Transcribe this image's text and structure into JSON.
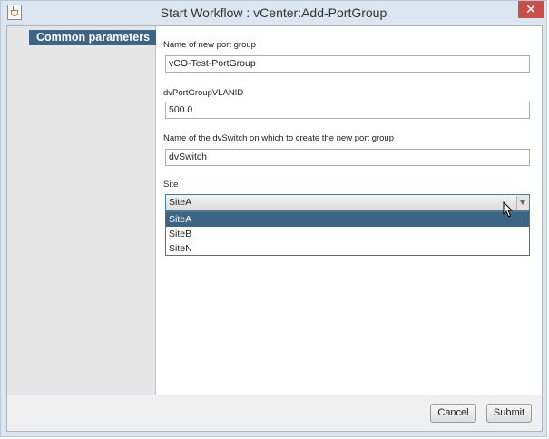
{
  "window": {
    "title": "Start Workflow : vCenter:Add-PortGroup",
    "close_glyph": "✕"
  },
  "sidebar": {
    "items": [
      {
        "label": "Common parameters",
        "selected": true
      }
    ]
  },
  "form": {
    "port_group_name": {
      "label": "Name of new port group",
      "value": "vCO-Test-PortGroup"
    },
    "vlan_id": {
      "label": "dvPortGroupVLANID",
      "value": "500.0"
    },
    "dvswitch": {
      "label": "Name of the dvSwitch on which to create the new port group",
      "value": "dvSwitch"
    },
    "site": {
      "label": "Site",
      "value": "SiteA",
      "options": [
        "SiteA",
        "SiteB",
        "SiteN"
      ],
      "highlighted": "SiteA"
    }
  },
  "footer": {
    "cancel_label": "Cancel",
    "submit_label": "Submit"
  },
  "colors": {
    "accent": "#3c6585",
    "close": "#c7504a",
    "frame": "#dbe6f1"
  },
  "icons": [
    "java-app-icon",
    "close-icon",
    "chevron-down-icon",
    "mouse-pointer-icon"
  ]
}
